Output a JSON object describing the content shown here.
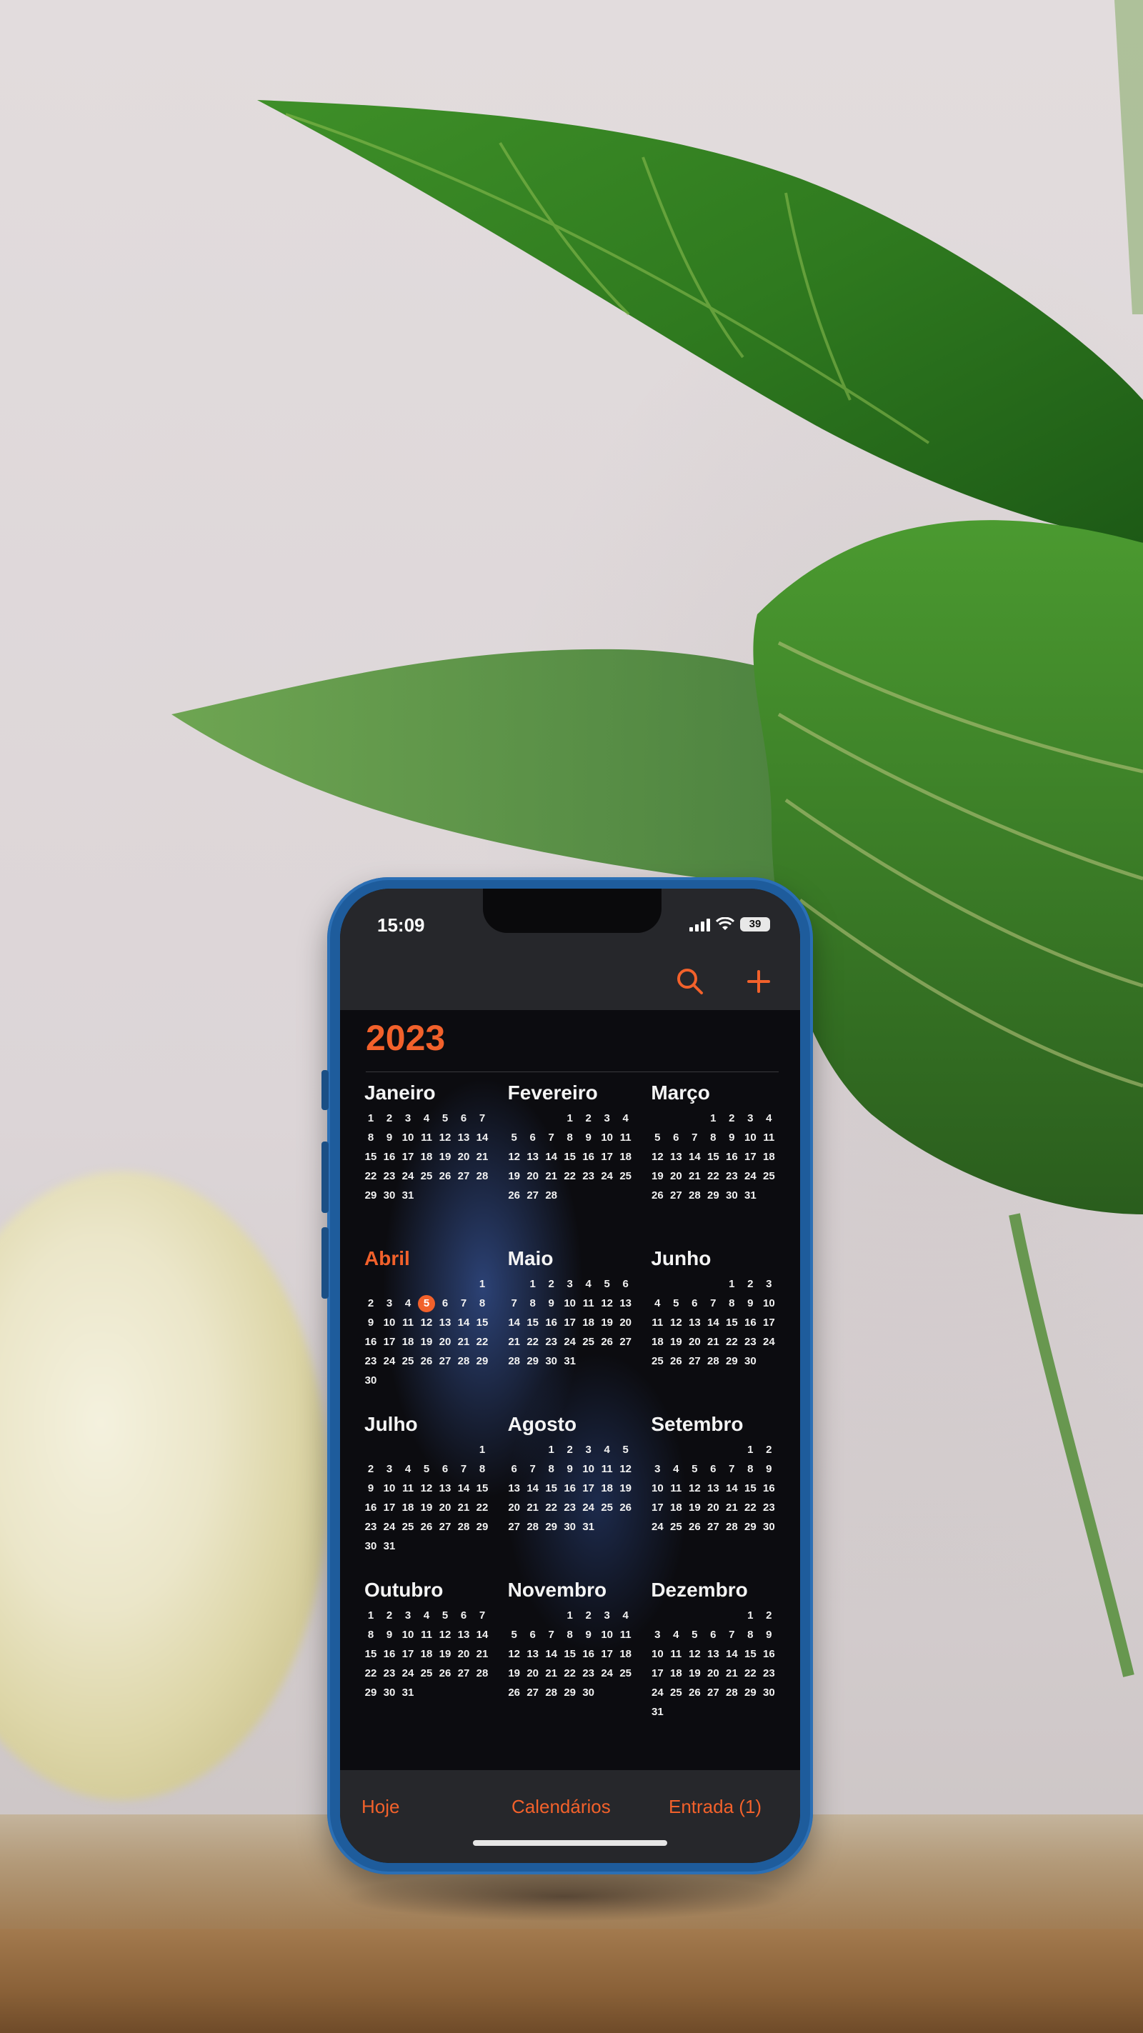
{
  "status_bar": {
    "time": "15:09",
    "battery": "39"
  },
  "toolbar": {
    "search_icon": "search-icon",
    "add_icon": "plus-icon"
  },
  "calendar": {
    "year": "2023",
    "months": [
      {
        "name": "Janeiro",
        "offset": 0,
        "days": 31
      },
      {
        "name": "Fevereiro",
        "offset": 3,
        "days": 28
      },
      {
        "name": "Março",
        "offset": 3,
        "days": 31
      },
      {
        "name": "Abril",
        "offset": 6,
        "days": 30,
        "current": true,
        "today": 5
      },
      {
        "name": "Maio",
        "offset": 1,
        "days": 31
      },
      {
        "name": "Junho",
        "offset": 4,
        "days": 30
      },
      {
        "name": "Julho",
        "offset": 6,
        "days": 31
      },
      {
        "name": "Agosto",
        "offset": 2,
        "days": 31
      },
      {
        "name": "Setembro",
        "offset": 5,
        "days": 30
      },
      {
        "name": "Outubro",
        "offset": 0,
        "days": 31
      },
      {
        "name": "Novembro",
        "offset": 3,
        "days": 30
      },
      {
        "name": "Dezembro",
        "offset": 5,
        "days": 31
      }
    ]
  },
  "tabbar": {
    "today": "Hoje",
    "calendars": "Calendários",
    "inbox": "Entrada (1)"
  },
  "colors": {
    "accent": "#f2612b",
    "phone_frame": "#1e5c9c",
    "screen_bg": "#0c0c10"
  }
}
